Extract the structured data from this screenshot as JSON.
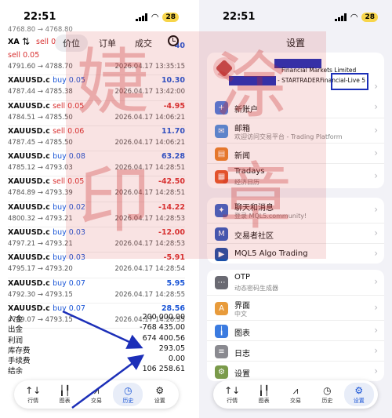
{
  "left_screen": {
    "status": {
      "time": "22:51",
      "battery": "28"
    },
    "toolbar": {
      "sort_icon": "sort-icon",
      "tabs": [
        "价位",
        "订单",
        "成交"
      ],
      "active_tab": 0,
      "clock_icon": "history-clock-icon"
    },
    "partial_rows": {
      "top_price": "4768.80 → 4768.80",
      "xa_label": "XA",
      "xa_side": "sell 0.0",
      "xa_profit": "40"
    },
    "trades": [
      {
        "symbol": "",
        "side": "sell 0.05",
        "side_type": "sell",
        "price": "4791.60 → 4788.70",
        "time": "2026.04.17 13:35:15",
        "profit": "",
        "profit_type": "pos"
      },
      {
        "symbol": "XAUUSD.c",
        "side": "buy 0.05",
        "side_type": "buy",
        "price": "4787.44 → 4785.38",
        "time": "2026.04.17 13:42:00",
        "profit": "10.30",
        "profit_type": "pos"
      },
      {
        "symbol": "XAUUSD.c",
        "side": "sell 0.05",
        "side_type": "sell",
        "price": "4784.51 → 4785.50",
        "time": "2026.04.17 14:06:21",
        "profit": "-4.95",
        "profit_type": "neg"
      },
      {
        "symbol": "XAUUSD.c",
        "side": "sell 0.06",
        "side_type": "sell",
        "price": "4787.45 → 4785.50",
        "time": "2026.04.17 14:06:21",
        "profit": "11.70",
        "profit_type": "pos"
      },
      {
        "symbol": "XAUUSD.c",
        "side": "buy 0.08",
        "side_type": "buy",
        "price": "4785.12 → 4793.03",
        "time": "2026.04.17 14:28:51",
        "profit": "63.28",
        "profit_type": "pos"
      },
      {
        "symbol": "XAUUSD.c",
        "side": "sell 0.05",
        "side_type": "sell",
        "price": "4784.89 → 4793.39",
        "time": "2026.04.17 14:28:51",
        "profit": "-42.50",
        "profit_type": "neg"
      },
      {
        "symbol": "XAUUSD.c",
        "side": "buy 0.02",
        "side_type": "buy",
        "price": "4800.32 → 4793.21",
        "time": "2026.04.17 14:28:53",
        "profit": "-14.22",
        "profit_type": "neg"
      },
      {
        "symbol": "XAUUSD.c",
        "side": "buy 0.03",
        "side_type": "buy",
        "price": "4797.21 → 4793.21",
        "time": "2026.04.17 14:28:53",
        "profit": "-12.00",
        "profit_type": "neg"
      },
      {
        "symbol": "XAUUSD.c",
        "side": "buy 0.03",
        "side_type": "buy",
        "price": "4795.17 → 4793.20",
        "time": "2026.04.17 14:28:54",
        "profit": "-5.91",
        "profit_type": "neg"
      },
      {
        "symbol": "XAUUSD.c",
        "side": "buy 0.07",
        "side_type": "buy",
        "price": "4792.30 → 4793.15",
        "time": "2026.04.17 14:28:55",
        "profit": "5.95",
        "profit_type": "pos"
      },
      {
        "symbol": "XAUUSD.c",
        "side": "buy 0.07",
        "side_type": "buy",
        "price": "4789.07 → 4793.15",
        "time": "2026.04.17 14:28:55",
        "profit": "28.56",
        "profit_type": "pos"
      }
    ],
    "summary": [
      {
        "label": "入金",
        "value": "200 000.00"
      },
      {
        "label": "出金",
        "value": "-768 435.00"
      },
      {
        "label": "利润",
        "value": "674 400.56"
      },
      {
        "label": "库存费",
        "value": "293.05"
      },
      {
        "label": "手续费",
        "value": "0.00"
      },
      {
        "label": "结余",
        "value": "106 258.61"
      }
    ],
    "tabbar": [
      {
        "label": "行情",
        "icon": "↑↓",
        "icon_name": "quotes-icon"
      },
      {
        "label": "图表",
        "icon": "╽╿",
        "icon_name": "chart-icon"
      },
      {
        "label": "交易",
        "icon": "⩘",
        "icon_name": "trade-icon"
      },
      {
        "label": "历史",
        "icon": "◷",
        "icon_name": "history-icon"
      },
      {
        "label": "设置",
        "icon": "⚙",
        "icon_name": "settings-icon"
      }
    ],
    "active_tab_index": 3
  },
  "right_screen": {
    "status": {
      "time": "22:51",
      "battery": "28"
    },
    "title": "设置",
    "account": {
      "company": "Financial Markets Limited",
      "server": "- STARTRADERFinancial-Live 5",
      "logo_icon": "broker-logo-icon"
    },
    "group1": [
      {
        "label": "新账户",
        "sub": "",
        "icon": "+",
        "icon_name": "new-account-icon",
        "color": "#4a7de0"
      },
      {
        "label": "邮箱",
        "sub": "欢迎访问交易平台 - Trading Platform",
        "icon": "✉",
        "icon_name": "mail-icon",
        "color": "#4a90e2"
      },
      {
        "label": "新闻",
        "sub": "",
        "icon": "▤",
        "icon_name": "news-icon",
        "color": "#e8822a"
      },
      {
        "label": "Tradays",
        "sub": "经济日历",
        "icon": "▦",
        "icon_name": "tradays-icon",
        "color": "#e6572b"
      }
    ],
    "group2": [
      {
        "label": "聊天和消息",
        "sub": "登录 MQL5.community!",
        "icon": "✦",
        "icon_name": "chat-icon",
        "color": "#3a63c9"
      },
      {
        "label": "交易者社区",
        "sub": "",
        "icon": "M",
        "icon_name": "mql5-community-icon",
        "color": "#2f5bc1"
      },
      {
        "label": "MQL5 Algo Trading",
        "sub": "",
        "icon": "▶",
        "icon_name": "algo-trading-icon",
        "color": "#1b4fa8"
      }
    ],
    "group3": [
      {
        "label": "OTP",
        "sub": "动态密码生成器",
        "icon": "⋯",
        "icon_name": "otp-icon",
        "color": "#6a6a72"
      },
      {
        "label": "界面",
        "sub": "中文",
        "icon": "A",
        "icon_name": "interface-icon",
        "color": "#e89b3b"
      },
      {
        "label": "图表",
        "sub": "",
        "icon": "╽",
        "icon_name": "chart-settings-icon",
        "color": "#3b7be0"
      },
      {
        "label": "日志",
        "sub": "",
        "icon": "≡",
        "icon_name": "journal-icon",
        "color": "#8a8a90"
      },
      {
        "label": "设置",
        "sub": "",
        "icon": "⚙",
        "icon_name": "settings-row-icon",
        "color": "#7a9a4a"
      }
    ],
    "tabbar": [
      {
        "label": "行情",
        "icon": "↑↓",
        "icon_name": "quotes-icon"
      },
      {
        "label": "图表",
        "icon": "╽╿",
        "icon_name": "chart-icon"
      },
      {
        "label": "交易",
        "icon": "⩘",
        "icon_name": "trade-icon"
      },
      {
        "label": "历史",
        "icon": "◷",
        "icon_name": "history-icon"
      },
      {
        "label": "设置",
        "icon": "⚙",
        "icon_name": "settings-icon"
      }
    ],
    "active_tab_index": 4
  },
  "watermark": {
    "chars": [
      "婕",
      "涂",
      "印",
      "章"
    ]
  }
}
